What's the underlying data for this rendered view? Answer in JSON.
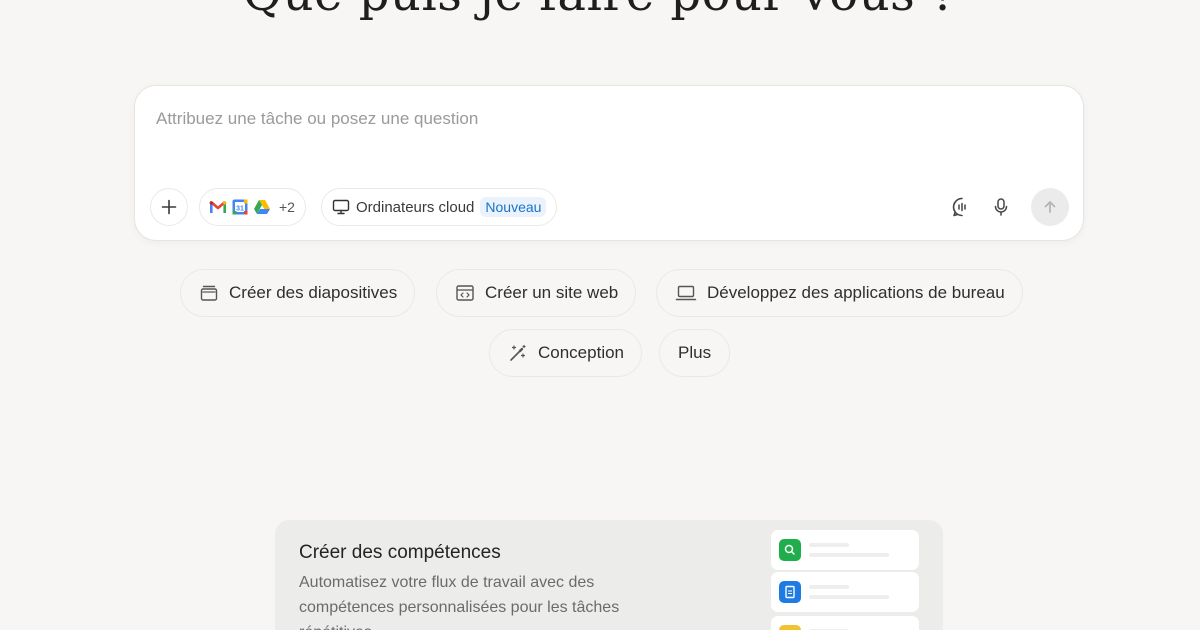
{
  "headline": "Que puis-je faire pour vous ?",
  "composer": {
    "placeholder": "Attribuez une tâche ou posez une question",
    "value": "",
    "plus_icon": "plus-icon",
    "connectors": {
      "icons": [
        "gmail-icon",
        "google-calendar-icon",
        "google-drive-icon"
      ],
      "more_label": "+2"
    },
    "cloud_computers": {
      "icon": "monitor-icon",
      "label": "Ordinateurs cloud",
      "badge": "Nouveau"
    },
    "voice_chat_icon": "voice-chat-icon",
    "mic_icon": "microphone-icon",
    "send_icon": "arrow-up-icon"
  },
  "suggestions": [
    {
      "icon": "slides-icon",
      "label": "Créer des diapositives"
    },
    {
      "icon": "website-icon",
      "label": "Créer un site web"
    },
    {
      "icon": "laptop-icon",
      "label": "Développez des applications de bureau"
    },
    {
      "icon": "design-wand-icon",
      "label": "Conception"
    },
    {
      "label": "Plus"
    }
  ],
  "skills_card": {
    "title": "Créer des compétences",
    "description": "Automatisez votre flux de travail avec des compétences personnalisées pour les tâches répétitives",
    "preview_colors": [
      "#1fae4b",
      "#1e7be6",
      "#f1c232"
    ]
  },
  "colors": {
    "background": "#f7f6f4",
    "accent_blue": "#1a73c8",
    "badge_bg": "#eaf3fc"
  }
}
